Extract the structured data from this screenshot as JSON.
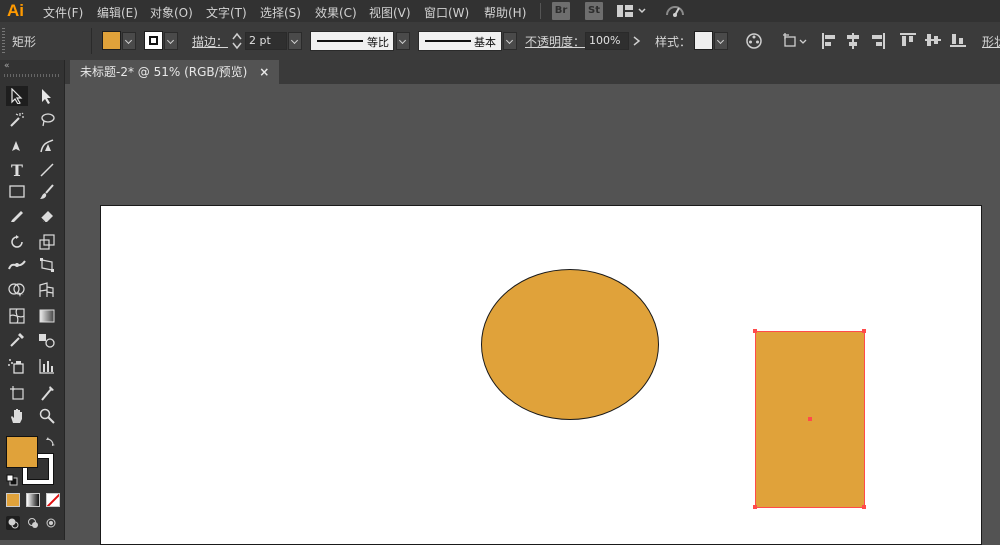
{
  "app": {
    "logo": "Ai"
  },
  "menu": [
    "文件(F)",
    "编辑(E)",
    "对象(O)",
    "文字(T)",
    "选择(S)",
    "效果(C)",
    "视图(V)",
    "窗口(W)",
    "帮助(H)"
  ],
  "bridge": {
    "br": "Br",
    "st": "St"
  },
  "control": {
    "object_type": "矩形",
    "stroke_label": "描边：",
    "stroke_value": "2 pt",
    "profile_label": "等比",
    "brush_label": "基本",
    "opacity_label": "不透明度：",
    "opacity_value": "100%",
    "style_label": "样式：",
    "shape_label": "形状"
  },
  "document": {
    "tab_title": "未标题-2* @ 51% (RGB/预览)",
    "close_glyph": "×"
  },
  "colors": {
    "fill": "#e0a23a",
    "stroke": "#1a1a1a",
    "selection": "#ff4b4b"
  },
  "objects": [
    {
      "type": "ellipse",
      "fill": "#e0a23a"
    },
    {
      "type": "rectangle",
      "fill": "#e0a23a",
      "selected": true
    }
  ]
}
